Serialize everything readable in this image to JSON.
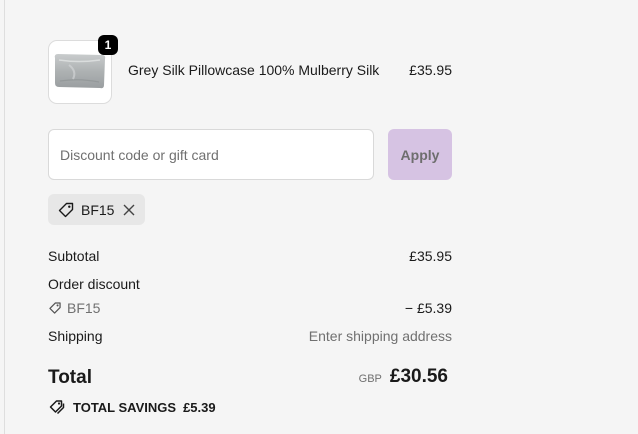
{
  "cart": {
    "items": [
      {
        "quantity": "1",
        "name": "Grey Silk Pillowcase 100% Mulberry Silk",
        "price": "£35.95",
        "image_icon": "grey-pillowcase-image"
      }
    ]
  },
  "discount": {
    "placeholder": "Discount code or gift card",
    "value": "",
    "apply_label": "Apply",
    "applied_code": "BF15"
  },
  "summary": {
    "subtotal_label": "Subtotal",
    "subtotal_value": "£35.95",
    "order_discount_label": "Order discount",
    "discount_code": "BF15",
    "discount_value": "− £5.39",
    "shipping_label": "Shipping",
    "shipping_value": "Enter shipping address",
    "total_label": "Total",
    "currency": "GBP",
    "total_value": "£30.56",
    "savings_label": "TOTAL SAVINGS",
    "savings_value": "£5.39"
  },
  "colors": {
    "apply_button_bg": "#d6c3e3",
    "badge_bg": "#000000",
    "chip_bg": "#e7e7e7"
  }
}
